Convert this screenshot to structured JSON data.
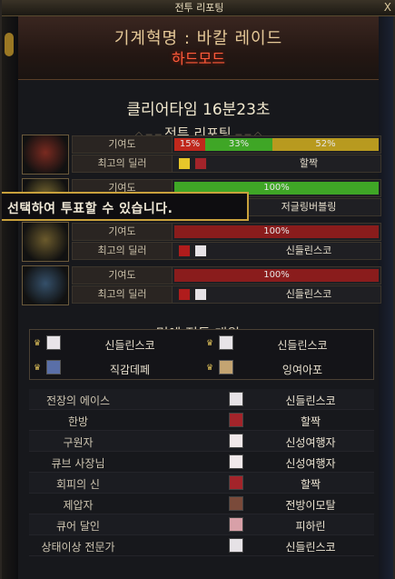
{
  "window": {
    "title": "전투 리포팅",
    "close_label": "X"
  },
  "raid": {
    "name": "기계혁명 : 바칼 레이드",
    "difficulty": "하드모드"
  },
  "clear_time": "클리어타임 16분23초",
  "report_section": {
    "title": "전투 리포팅"
  },
  "labels": {
    "contribution": "기여도",
    "best_dealer": "최고의 딜러"
  },
  "parties": [
    {
      "portrait_icon": "red-demon-portrait-icon",
      "contribution": [
        {
          "text": "15%",
          "fraction": 0.15,
          "color": "#c0281c"
        },
        {
          "text": "33%",
          "fraction": 0.33,
          "color": "#3fa626"
        },
        {
          "text": "52%",
          "fraction": 0.52,
          "color": "#b89a1f"
        }
      ],
      "best_dealer_name": "할짝",
      "best_icons": [
        "gold-3-icon",
        "red-hair-avatar-icon"
      ]
    },
    {
      "portrait_icon": "gold-demon-portrait-icon",
      "contribution": [
        {
          "text": "100%",
          "fraction": 1.0,
          "color": "#3fa626"
        }
      ],
      "best_dealer_name": "저글링버블링",
      "best_icons": []
    },
    {
      "portrait_icon": "gold-demon-portrait-icon",
      "contribution": [
        {
          "text": "100%",
          "fraction": 1.0,
          "color": "#8a1c1c"
        }
      ],
      "best_dealer_name": "신들린스코",
      "best_icons": [
        "slash-icon",
        "white-hair-avatar-icon"
      ]
    },
    {
      "portrait_icon": "blue-demon-portrait-icon",
      "contribution": [
        {
          "text": "100%",
          "fraction": 1.0,
          "color": "#8a1c1c"
        }
      ],
      "best_dealer_name": "신들린스코",
      "best_icons": [
        "slash-icon",
        "white-hair-avatar-icon"
      ]
    }
  ],
  "tooltip": "선택하여 투표할 수 있습니다.",
  "honor_section": {
    "title": "명예 전투 대원",
    "members": [
      "신들린스코",
      "신들린스코",
      "직감데페",
      "잉여아포"
    ]
  },
  "awards": [
    {
      "title": "전장의 에이스",
      "name": "신들린스코"
    },
    {
      "title": "한방",
      "name": "할짝"
    },
    {
      "title": "구원자",
      "name": "신성여행자"
    },
    {
      "title": "큐브 사장님",
      "name": "신성여행자"
    },
    {
      "title": "회피의 신",
      "name": "할짝"
    },
    {
      "title": "제압자",
      "name": "전방이모탈"
    },
    {
      "title": "큐어 달인",
      "name": "피하린"
    },
    {
      "title": "상태이상 전문가",
      "name": "신들린스코"
    }
  ],
  "colors": {
    "accent_gold": "#c9a13c",
    "hard_mode": "#ff5a3a",
    "green_bar": "#3fa626",
    "red_bar": "#8a1c1c"
  }
}
